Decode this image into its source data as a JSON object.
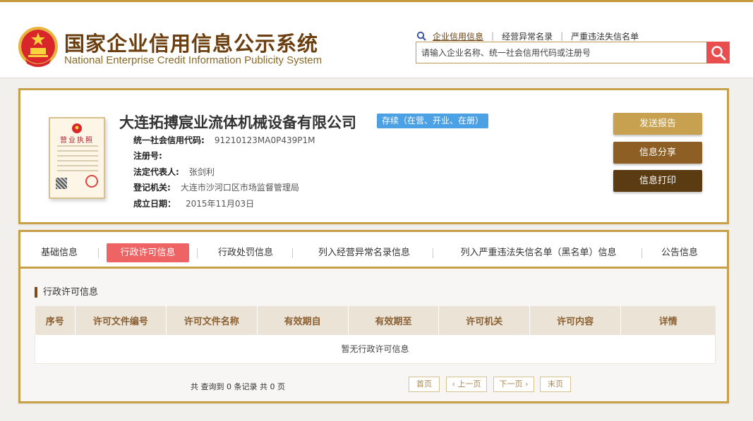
{
  "header": {
    "title_cn": "国家企业信用信息公示系统",
    "title_en": "National Enterprise Credit Information Publicity System",
    "links": [
      {
        "label": "企业信用信息"
      },
      {
        "label": "经营异常名录"
      },
      {
        "label": "严重违法失信名单"
      }
    ],
    "search": {
      "placeholder": "请输入企业名称、统一社会信用代码或注册号",
      "value": ""
    }
  },
  "company": {
    "license_title": "营业执照",
    "name": "大连拓搏宸业流体机械设备有限公司",
    "status": "存续（在营、开业、在册）",
    "fields": [
      {
        "label": "统一社会信用代码:",
        "value": "91210123MA0P439P1M"
      },
      {
        "label": "注册号:",
        "value": ""
      },
      {
        "label": "法定代表人:",
        "value": "张剑利"
      },
      {
        "label": "登记机关:",
        "value": "大连市沙河口区市场监督管理局"
      },
      {
        "label": "成立日期：",
        "value": "2015年11月03日"
      }
    ],
    "actions": {
      "send": "发送报告",
      "share": "信息分享",
      "print": "信息打印"
    }
  },
  "tabs": [
    {
      "label": "基础信息"
    },
    {
      "label": "行政许可信息"
    },
    {
      "label": "行政处罚信息"
    },
    {
      "label": "列入经营异常名录信息"
    },
    {
      "label": "列入严重违法失信名单（黑名单）信息"
    },
    {
      "label": "公告信息"
    }
  ],
  "section": {
    "title": "行政许可信息",
    "columns": [
      "序号",
      "许可文件编号",
      "许可文件名称",
      "有效期自",
      "有效期至",
      "许可机关",
      "许可内容",
      "详情"
    ],
    "empty_text": "暂无行政许可信息"
  },
  "pager": {
    "summary": "共 查询到 0 条记录 共 0 页",
    "first": "首页",
    "prev": "上一页",
    "next": "下一页",
    "last": "末页"
  },
  "colors": {
    "gold_border": "#c9a04a",
    "active_tab": "#ee6363",
    "status_blue": "#4ba1e3",
    "search_red": "#e94e4e"
  }
}
